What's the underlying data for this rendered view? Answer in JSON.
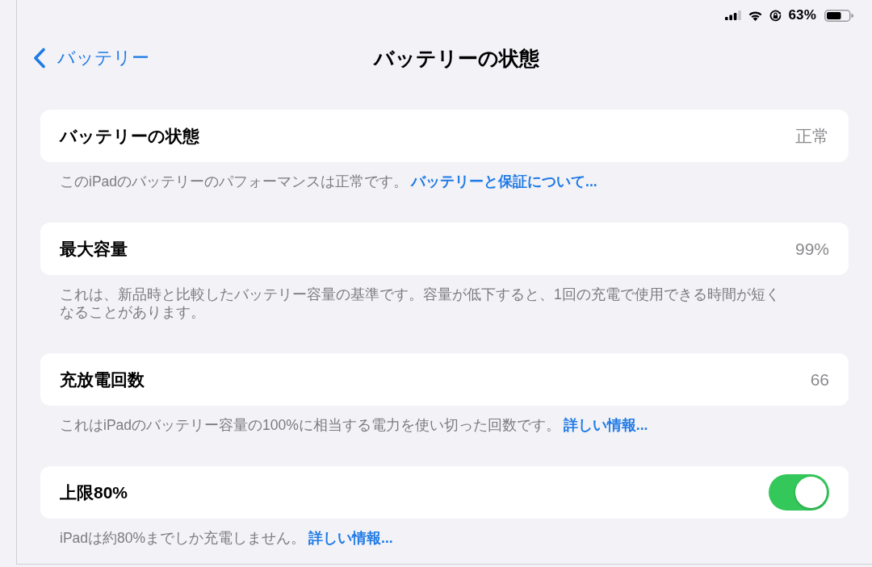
{
  "status_bar": {
    "battery_percent": "63%"
  },
  "nav": {
    "back": "バッテリー",
    "title": "バッテリーの状態"
  },
  "sections": [
    {
      "kind": "value",
      "label": "バッテリーの状態",
      "value": "正常",
      "footer": {
        "text": "このiPadのバッテリーのパフォーマンスは正常です。",
        "link": "バッテリーと保証について..."
      }
    },
    {
      "kind": "value",
      "label": "最大容量",
      "value": "99%",
      "footer": {
        "text": "これは、新品時と比較したバッテリー容量の基準です。容量が低下すると、1回の充電で使用できる時間が短くなることがあります。"
      }
    },
    {
      "kind": "value",
      "label": "充放電回数",
      "value": "66",
      "footer": {
        "text": "これはiPadのバッテリー容量の100%に相当する電力を使い切った回数です。",
        "link": "詳しい情報..."
      }
    },
    {
      "kind": "toggle",
      "label": "上限80%",
      "on": true,
      "footer": {
        "text": "iPadは約80%までしか充電しません。",
        "link": "詳しい情報..."
      }
    }
  ]
}
